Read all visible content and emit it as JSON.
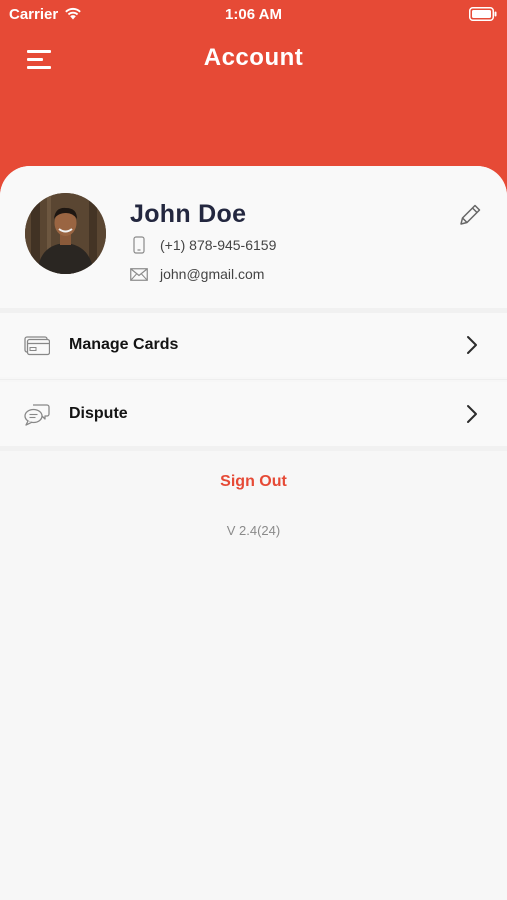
{
  "status_bar": {
    "carrier": "Carrier",
    "time": "1:06 AM"
  },
  "header": {
    "title": "Account",
    "color": "#e64a36"
  },
  "profile": {
    "name": "John Doe",
    "phone": "(+1) 878-945-6159",
    "email": "john@gmail.com"
  },
  "menu": [
    {
      "label": "Manage Cards",
      "icon": "credit-card-icon"
    },
    {
      "label": "Dispute",
      "icon": "chat-bubbles-icon"
    }
  ],
  "footer": {
    "sign_out": "Sign Out",
    "version": "V 2.4(24)"
  }
}
